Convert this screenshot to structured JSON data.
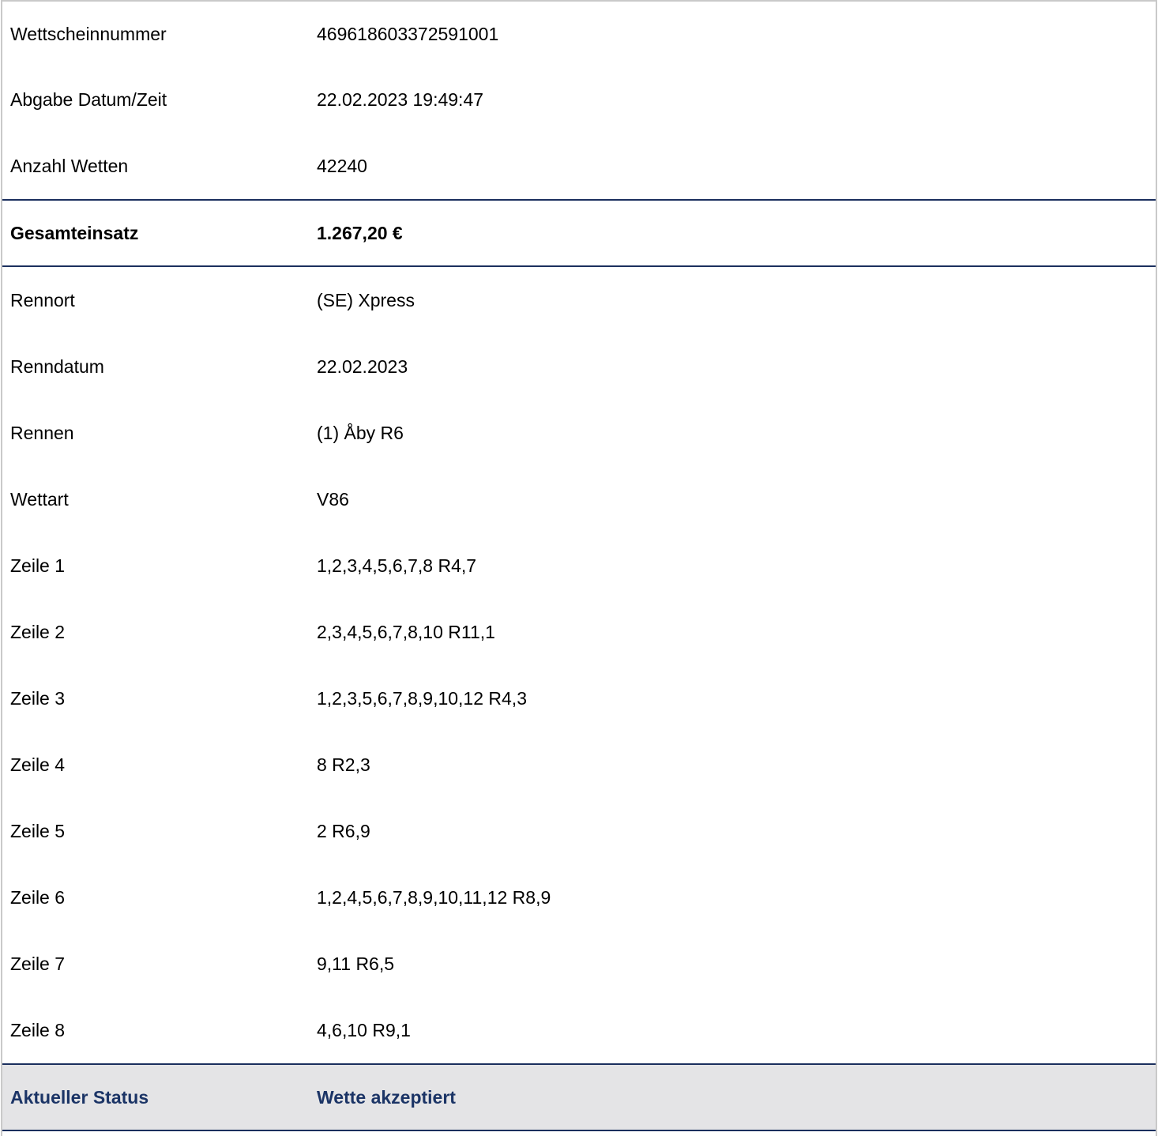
{
  "header_rows": [
    {
      "label": "Wettscheinnummer",
      "value": "469618603372591001"
    },
    {
      "label": "Abgabe Datum/Zeit",
      "value": "22.02.2023 19:49:47"
    },
    {
      "label": "Anzahl Wetten",
      "value": "42240"
    }
  ],
  "total": {
    "label": "Gesamteinsatz",
    "value": "1.267,20 €"
  },
  "detail_rows": [
    {
      "label": "Rennort",
      "value": "(SE) Xpress"
    },
    {
      "label": "Renndatum",
      "value": "22.02.2023"
    },
    {
      "label": "Rennen",
      "value": "(1) Åby R6"
    },
    {
      "label": "Wettart",
      "value": "V86"
    },
    {
      "label": "Zeile 1",
      "value": "1,2,3,4,5,6,7,8 R4,7"
    },
    {
      "label": "Zeile 2",
      "value": "2,3,4,5,6,7,8,10 R11,1"
    },
    {
      "label": "Zeile 3",
      "value": "1,2,3,5,6,7,8,9,10,12 R4,3"
    },
    {
      "label": "Zeile 4",
      "value": "8 R2,3"
    },
    {
      "label": "Zeile 5",
      "value": "2 R6,9"
    },
    {
      "label": "Zeile 6",
      "value": "1,2,4,5,6,7,8,9,10,11,12 R8,9"
    },
    {
      "label": "Zeile 7",
      "value": "9,11 R6,5"
    },
    {
      "label": "Zeile 8",
      "value": "4,6,10 R9,1"
    }
  ],
  "status": {
    "label": "Aktueller Status",
    "value": "Wette akzeptiert"
  },
  "colors": {
    "accent": "#1b2f5e",
    "status_text": "#1b3466",
    "status_background": "#e4e4e6",
    "outer_border": "#c9c9c9"
  }
}
